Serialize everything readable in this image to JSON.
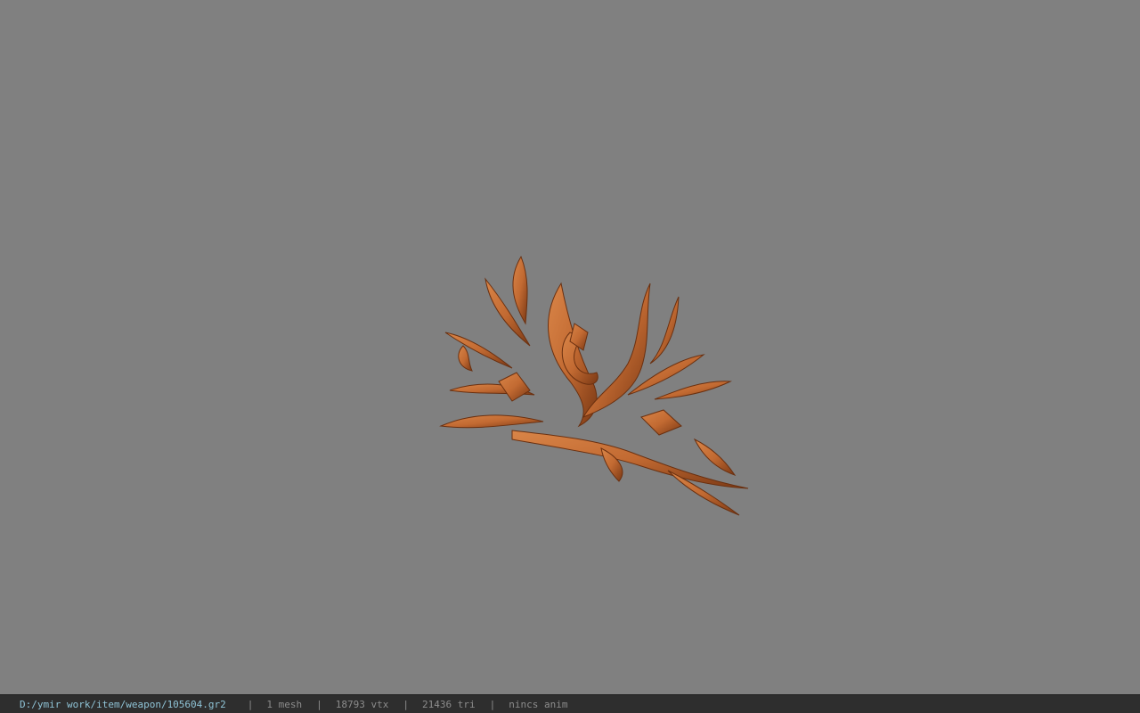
{
  "viewport": {
    "model_icon": "ornate-bronze-weapon-model"
  },
  "status": {
    "file_path": "D:/ymir work/item/weapon/105604.gr2",
    "separator": "|",
    "mesh_count": "1 mesh",
    "vertex_count": "18793 vtx",
    "triangle_count": "21436 tri",
    "animation": "nincs anim"
  },
  "colors": {
    "background": "#808080",
    "model_main": "#c26a32",
    "model_shadow": "#7a3814",
    "statusbar": "#2e2e2e",
    "path_text": "#8fc3d6"
  }
}
